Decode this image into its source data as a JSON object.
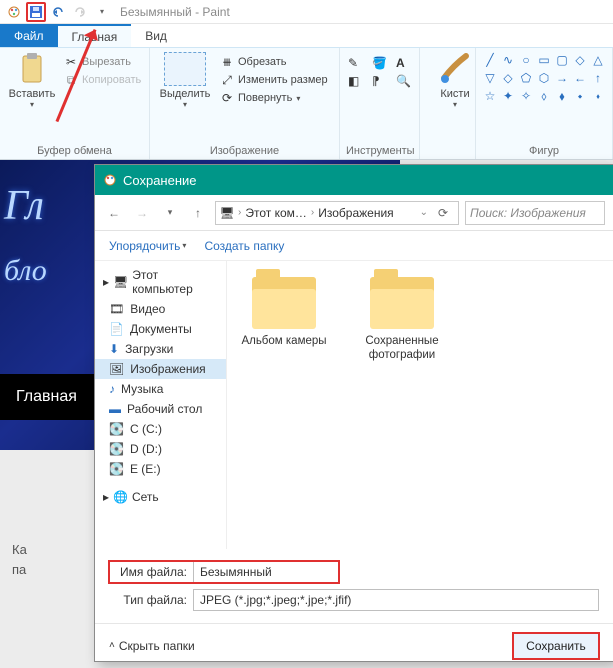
{
  "titlebar": {
    "doc_name": "Безымянный",
    "app_name": "Paint"
  },
  "tabs": {
    "file": "Файл",
    "home": "Главная",
    "view": "Вид"
  },
  "ribbon": {
    "clipboard": {
      "paste": "Вставить",
      "cut": "Вырезать",
      "copy": "Копировать",
      "group": "Буфер обмена"
    },
    "image": {
      "select": "Выделить",
      "crop": "Обрезать",
      "resize": "Изменить размер",
      "rotate": "Повернуть",
      "group": "Изображение"
    },
    "tools": {
      "group": "Инструменты"
    },
    "brushes": {
      "label": "Кисти"
    },
    "shapes": {
      "group": "Фигур"
    }
  },
  "canvas": {
    "t1": "Гл",
    "t2": "бло",
    "bar": "Главная"
  },
  "bottom": {
    "l1": "Ка",
    "l2": "па"
  },
  "dialog": {
    "title": "Сохранение",
    "breadcrumb": {
      "root": "Этот ком…",
      "cur": "Изображения"
    },
    "search_ph": "Поиск: Изображения",
    "organize": "Упорядочить",
    "newfolder": "Создать папку",
    "tree": {
      "thispc": "Этот компьютер",
      "videos": "Видео",
      "docs": "Документы",
      "downloads": "Загрузки",
      "pictures": "Изображения",
      "music": "Музыка",
      "desktop": "Рабочий стол",
      "c": "C (С:)",
      "d": "D (D:)",
      "e": "E (E:)",
      "network": "Сеть"
    },
    "folders": {
      "f1": "Альбом камеры",
      "f2": "Сохраненные фотографии"
    },
    "filename_lbl": "Имя файла:",
    "filename_val": "Безымянный",
    "filetype_lbl": "Тип файла:",
    "filetype_val": "JPEG (*.jpg;*.jpeg;*.jpe;*.jfif)",
    "hide": "Скрыть папки",
    "save": "Сохранить"
  }
}
